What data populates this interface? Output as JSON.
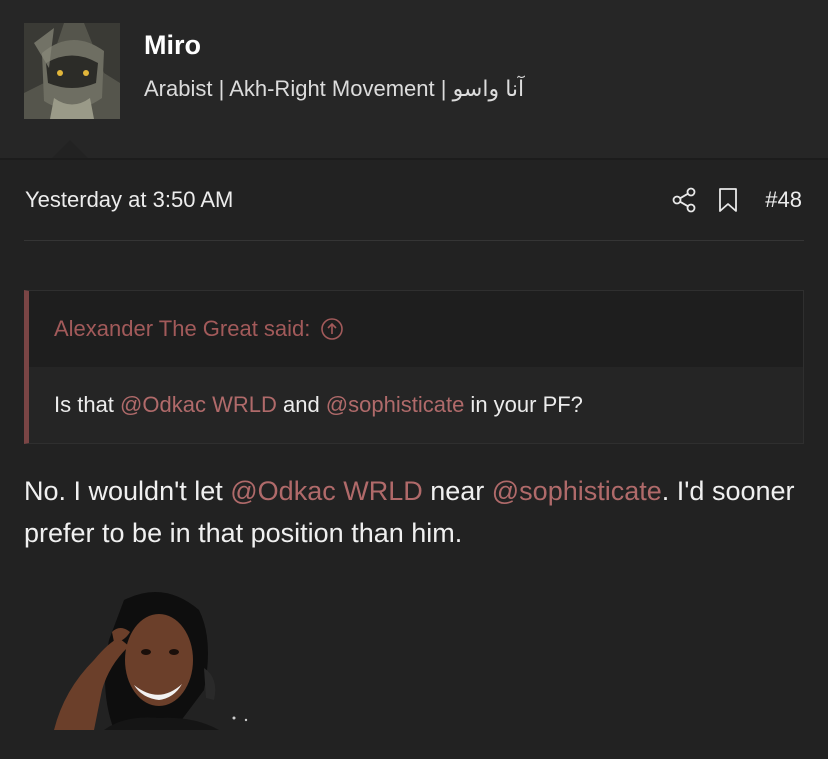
{
  "user": {
    "name": "Miro",
    "title": "Arabist | Akh-Right Movement | آنا واسو"
  },
  "post": {
    "timestamp": "Yesterday at 3:50 AM",
    "number": "#48",
    "quote": {
      "author_line": "Alexander The Great said:",
      "body_prefix": "Is that ",
      "mention1": "@Odkac WRLD",
      "body_mid": " and ",
      "mention2": "@sophisticate",
      "body_suffix": " in your PF?"
    },
    "message": {
      "part1": "No. I wouldn't let ",
      "mention1": "@Odkac WRLD",
      "part2": " near ",
      "mention2": "@sophisticate",
      "part3": ". I'd sooner prefer to be in that position than him."
    }
  },
  "icons": {
    "share": "share-icon",
    "bookmark": "bookmark-icon",
    "quote_jump": "arrow-up-circle-icon"
  },
  "colors": {
    "background": "#222222",
    "mention": "#b06a6a",
    "quote_border": "#7a4545"
  }
}
